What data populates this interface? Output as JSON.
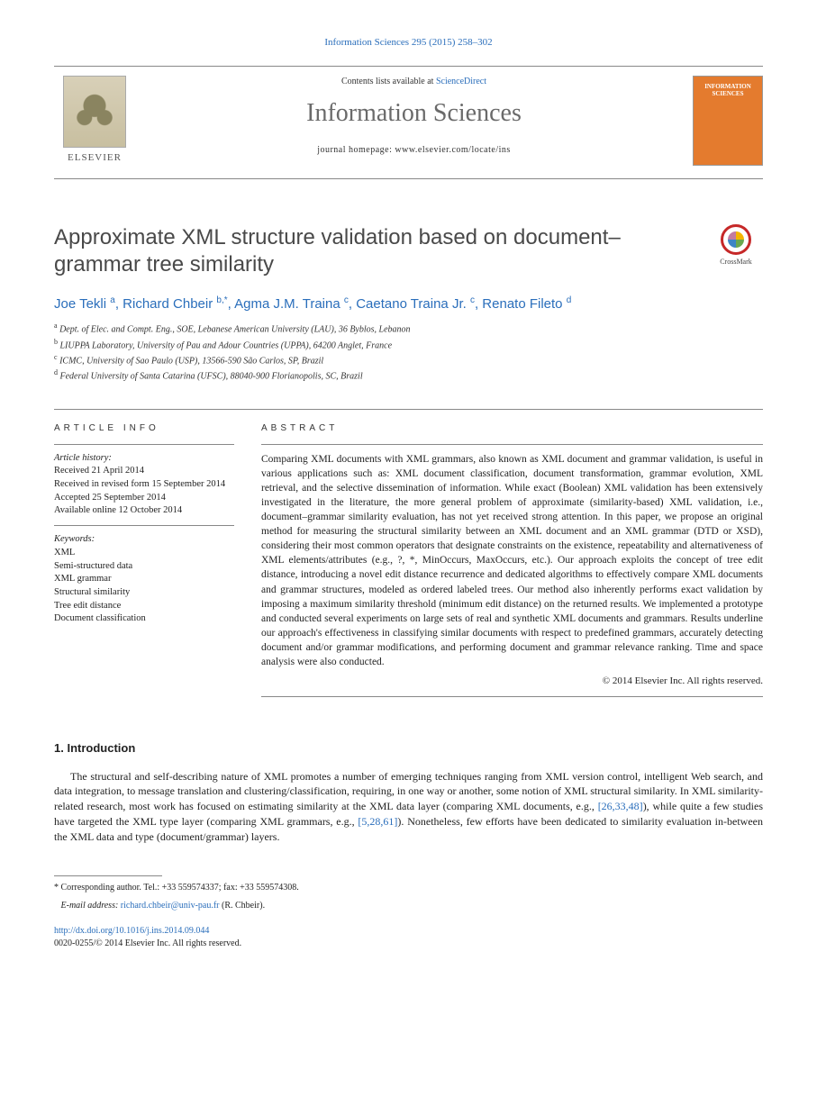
{
  "citation_line": "Information Sciences 295 (2015) 258–302",
  "contents_prefix": "Contents lists available at ",
  "contents_link": "ScienceDirect",
  "journal_name": "Information Sciences",
  "homepage_prefix": "journal homepage: ",
  "homepage_url": "www.elsevier.com/locate/ins",
  "elsevier_label": "ELSEVIER",
  "cover_title": "INFORMATION SCIENCES",
  "crossmark_label": "CrossMark",
  "article_title": "Approximate XML structure validation based on document–grammar tree similarity",
  "authors": [
    {
      "name": "Joe Tekli",
      "marks": "a"
    },
    {
      "name": "Richard Chbeir",
      "marks": "b,*"
    },
    {
      "name": "Agma J.M. Traina",
      "marks": "c"
    },
    {
      "name": "Caetano Traina Jr.",
      "marks": "c"
    },
    {
      "name": "Renato Fileto",
      "marks": "d"
    }
  ],
  "affiliations": [
    {
      "mark": "a",
      "text": "Dept. of Elec. and Compt. Eng., SOE, Lebanese American University (LAU), 36 Byblos, Lebanon"
    },
    {
      "mark": "b",
      "text": "LIUPPA Laboratory, University of Pau and Adour Countries (UPPA), 64200 Anglet, France"
    },
    {
      "mark": "c",
      "text": "ICMC, University of Sao Paulo (USP), 13566-590 São Carlos, SP, Brazil"
    },
    {
      "mark": "d",
      "text": "Federal University of Santa Catarina (UFSC), 88040-900 Florianopolis, SC, Brazil"
    }
  ],
  "info_heading": "ARTICLE INFO",
  "abstract_heading": "ABSTRACT",
  "history_label": "Article history:",
  "history": [
    "Received 21 April 2014",
    "Received in revised form 15 September 2014",
    "Accepted 25 September 2014",
    "Available online 12 October 2014"
  ],
  "keywords_label": "Keywords:",
  "keywords": [
    "XML",
    "Semi-structured data",
    "XML grammar",
    "Structural similarity",
    "Tree edit distance",
    "Document classification"
  ],
  "abstract": "Comparing XML documents with XML grammars, also known as XML document and grammar validation, is useful in various applications such as: XML document classification, document transformation, grammar evolution, XML retrieval, and the selective dissemination of information. While exact (Boolean) XML validation has been extensively investigated in the literature, the more general problem of approximate (similarity-based) XML validation, i.e., document–grammar similarity evaluation, has not yet received strong attention. In this paper, we propose an original method for measuring the structural similarity between an XML document and an XML grammar (DTD or XSD), considering their most common operators that designate constraints on the existence, repeatability and alternativeness of XML elements/attributes (e.g., ?, *, MinOccurs, MaxOccurs, etc.). Our approach exploits the concept of tree edit distance, introducing a novel edit distance recurrence and dedicated algorithms to effectively compare XML documents and grammar structures, modeled as ordered labeled trees. Our method also inherently performs exact validation by imposing a maximum similarity threshold (minimum edit distance) on the returned results. We implemented a prototype and conducted several experiments on large sets of real and synthetic XML documents and grammars. Results underline our approach's effectiveness in classifying similar documents with respect to predefined grammars, accurately detecting document and/or grammar modifications, and performing document and grammar relevance ranking. Time and space analysis were also conducted.",
  "abstract_copyright": "© 2014 Elsevier Inc. All rights reserved.",
  "section1_heading": "1. Introduction",
  "intro_p1_a": "The structural and self-describing nature of XML promotes a number of emerging techniques ranging from XML version control, intelligent Web search, and data integration, to message translation and clustering/classification, requiring, in one way or another, some notion of XML structural similarity. In XML similarity-related research, most work has focused on estimating similarity at the XML data layer (comparing XML documents, e.g., ",
  "intro_ref1": "[26,33,48]",
  "intro_p1_b": "), while quite a few studies have targeted the XML type layer (comparing XML grammars, e.g., ",
  "intro_ref2": "[5,28,61]",
  "intro_p1_c": "). Nonetheless, few efforts have been dedicated to similarity evaluation in-between the XML data and type (document/grammar) layers.",
  "corr_label": "* Corresponding author. Tel.: +33 559574337; fax: +33 559574308.",
  "email_label": "E-mail address:",
  "email": "richard.chbeir@univ-pau.fr",
  "email_owner": "(R. Chbeir).",
  "doi_url": "http://dx.doi.org/10.1016/j.ins.2014.09.044",
  "issn_line": "0020-0255/© 2014 Elsevier Inc. All rights reserved."
}
